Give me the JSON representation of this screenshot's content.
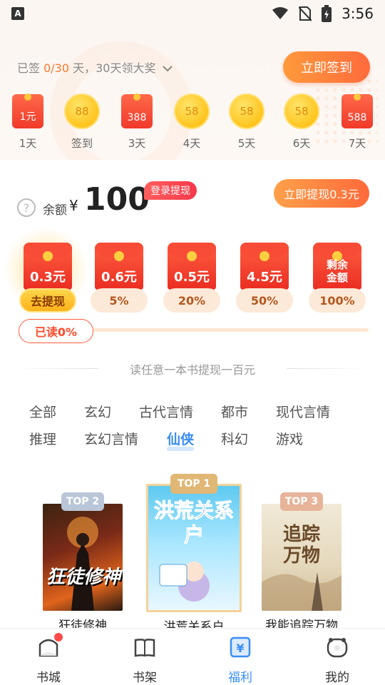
{
  "status_bar": {
    "time": "3:56",
    "notification_icon": "A"
  },
  "checkin": {
    "prefix": "已签 ",
    "progress": "0/30",
    "suffix": " 天，30天领大奖",
    "button_label": "立即签到",
    "days": [
      {
        "reward": "1元",
        "label": "1天",
        "kind": "envelope"
      },
      {
        "reward": "88",
        "label": "签到",
        "kind": "coin"
      },
      {
        "reward": "388",
        "label": "3天",
        "kind": "envelope"
      },
      {
        "reward": "58",
        "label": "4天",
        "kind": "coin"
      },
      {
        "reward": "58",
        "label": "5天",
        "kind": "coin"
      },
      {
        "reward": "58",
        "label": "6天",
        "kind": "coin"
      },
      {
        "reward": "588",
        "label": "7天",
        "kind": "envelope"
      }
    ]
  },
  "balance": {
    "label": "余额",
    "currency": "¥",
    "amount": "100",
    "badge": "登录提现",
    "withdraw_button": "立即提现0.3元"
  },
  "rewards": [
    {
      "amount": "0.3元",
      "sub": "去提现"
    },
    {
      "amount": "0.6元",
      "sub": "5%"
    },
    {
      "amount": "0.5元",
      "sub": "20%"
    },
    {
      "amount": "4.5元",
      "sub": "50%"
    },
    {
      "amount": "剩余\n金额",
      "sub": "100%"
    }
  ],
  "read_progress": {
    "label": "已读0%",
    "fraction": 0.0
  },
  "divider_text": "读任意一本书提现一百元",
  "categories": [
    {
      "label": "全部",
      "active": false
    },
    {
      "label": "玄幻",
      "active": false
    },
    {
      "label": "古代言情",
      "active": false
    },
    {
      "label": "都市",
      "active": false
    },
    {
      "label": "现代言情",
      "active": false
    },
    {
      "label": "推理",
      "active": false
    },
    {
      "label": "玄幻言情",
      "active": false
    },
    {
      "label": "仙侠",
      "active": true
    },
    {
      "label": "科幻",
      "active": false
    },
    {
      "label": "游戏",
      "active": false
    }
  ],
  "books": [
    {
      "rank": "TOP 2",
      "title": "狂徒修神",
      "cover_text": "狂徒修神",
      "rank_color": "#b9c6d8"
    },
    {
      "rank": "TOP 1",
      "title": "洪荒关系户",
      "cover_text": "洪荒关系户",
      "rank_color": "#e0b774"
    },
    {
      "rank": "TOP 3",
      "title": "我能追踪万物",
      "cover_text": "追踪万物",
      "rank_color": "#e7b49a"
    }
  ],
  "bottom_nav": [
    {
      "label": "书城",
      "active": false,
      "badge": true
    },
    {
      "label": "书架",
      "active": false,
      "badge": false
    },
    {
      "label": "福利",
      "active": true,
      "badge": false
    },
    {
      "label": "我的",
      "active": false,
      "badge": false
    }
  ]
}
